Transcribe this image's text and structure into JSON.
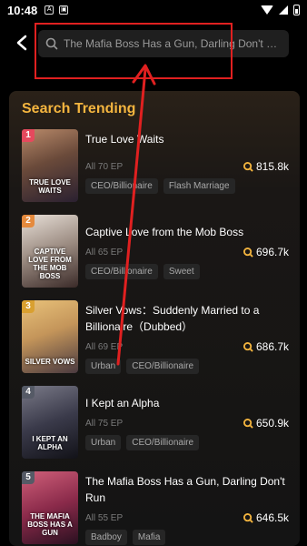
{
  "status": {
    "time": "10:48",
    "icon_a": "A",
    "icon_b": "▣"
  },
  "search": {
    "value": "The Mafia Boss Has a Gun, Darling Don't R..."
  },
  "panel": {
    "title": "Search Trending"
  },
  "colors": {
    "accent": "#f4b53f",
    "highlight": "#e02020"
  },
  "items": [
    {
      "rank": "1",
      "title": "True Love Waits",
      "ep": "All 70 EP",
      "views": "815.8k",
      "tags": [
        "CEO/Billionaire",
        "Flash Marriage"
      ],
      "cover": "TRUE LOVE WAITS"
    },
    {
      "rank": "2",
      "title": "Captive Love from the Mob Boss",
      "ep": "All 65 EP",
      "views": "696.7k",
      "tags": [
        "CEO/Billionaire",
        "Sweet"
      ],
      "cover": "CAPTIVE LOVE FROM THE MOB BOSS"
    },
    {
      "rank": "3",
      "title": "Silver Vows：Suddenly Married to a Billionaire（Dubbed）",
      "ep": "All 69 EP",
      "views": "686.7k",
      "tags": [
        "Urban",
        "CEO/Billionaire"
      ],
      "cover": "SILVER VOWS"
    },
    {
      "rank": "4",
      "title": "I Kept an Alpha",
      "ep": "All 75 EP",
      "views": "650.9k",
      "tags": [
        "Urban",
        "CEO/Billionaire"
      ],
      "cover": "I KEPT AN ALPHA"
    },
    {
      "rank": "5",
      "title": "The Mafia Boss Has a Gun, Darling Don't Run",
      "ep": "All 55 EP",
      "views": "646.5k",
      "tags": [
        "Badboy",
        "Mafia"
      ],
      "cover": "THE MAFIA BOSS HAS A GUN"
    }
  ]
}
